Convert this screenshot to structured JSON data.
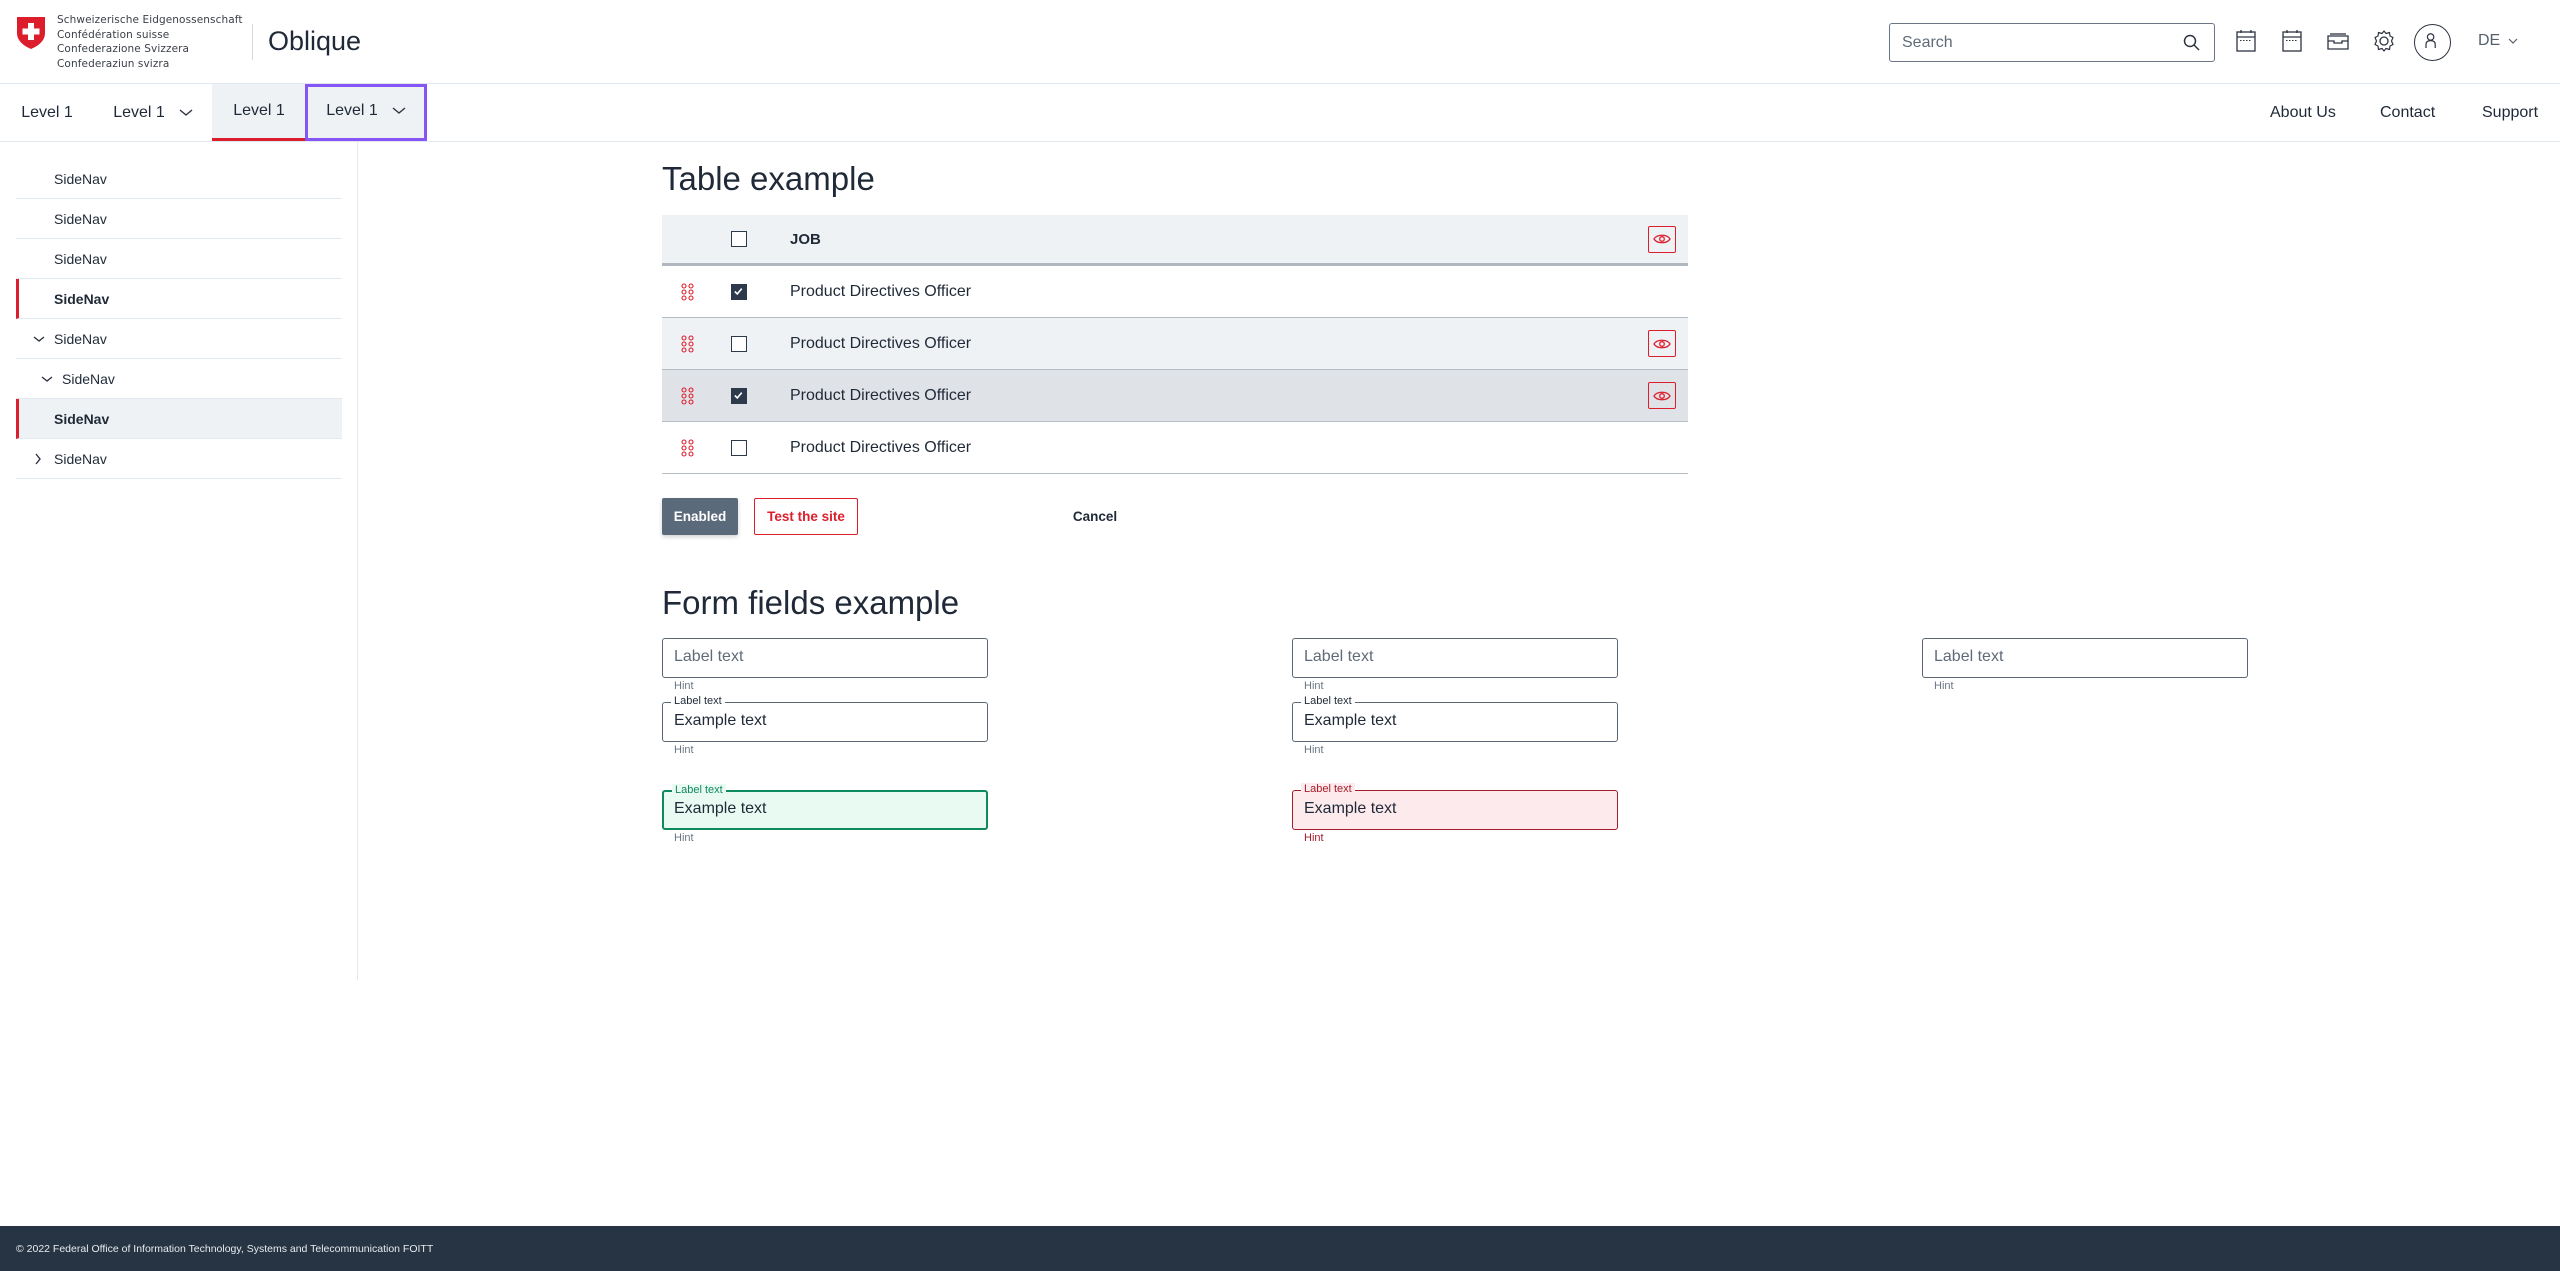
{
  "header": {
    "logo_lines": [
      "Schweizerische Eidgenossenschaft",
      "Confédération suisse",
      "Confederazione Svizzera",
      "Confederaziun svizra"
    ],
    "app_title": "Oblique",
    "search": {
      "placeholder": "Search",
      "value": ""
    },
    "icons": [
      "calendar-icon",
      "calendar-icon",
      "inbox-icon",
      "gear-icon",
      "user-icon"
    ],
    "language": "DE"
  },
  "top_nav": {
    "items": [
      {
        "label": "Level 1",
        "has_dropdown": false,
        "active": false,
        "focused": false
      },
      {
        "label": "Level 1",
        "has_dropdown": true,
        "active": false,
        "focused": false
      },
      {
        "label": "Level 1",
        "has_dropdown": false,
        "active": true,
        "focused": false
      },
      {
        "label": "Level 1",
        "has_dropdown": true,
        "active": true,
        "focused": true
      }
    ],
    "right_links": [
      "About Us",
      "Contact",
      "Support"
    ]
  },
  "sidebar": {
    "items": [
      {
        "label": "SideNav",
        "state": "default",
        "icon": null
      },
      {
        "label": "SideNav",
        "state": "default",
        "icon": null
      },
      {
        "label": "SideNav",
        "state": "default",
        "icon": null
      },
      {
        "label": "SideNav",
        "state": "active",
        "icon": null
      },
      {
        "label": "SideNav",
        "state": "expanded",
        "icon": "chevron-down-icon"
      },
      {
        "label": "SideNav",
        "state": "expanded-nested",
        "icon": "chevron-down-icon"
      },
      {
        "label": "SideNav",
        "state": "active-highlighted",
        "icon": null
      },
      {
        "label": "SideNav",
        "state": "collapsed",
        "icon": "chevron-right-icon"
      }
    ]
  },
  "table_section": {
    "title": "Table example",
    "header": {
      "column": "JOB",
      "checked": false
    },
    "rows": [
      {
        "job": "Product Directives Officer",
        "checked": true,
        "show_eye": false
      },
      {
        "job": "Product Directives Officer",
        "checked": false,
        "show_eye": true
      },
      {
        "job": "Product Directives Officer",
        "checked": true,
        "show_eye": true
      },
      {
        "job": "Product Directives Officer",
        "checked": false,
        "show_eye": false
      }
    ],
    "buttons": {
      "primary": "Enabled",
      "secondary": "Test the site",
      "tertiary": "Cancel"
    }
  },
  "form_section": {
    "title": "Form fields example",
    "fields": [
      {
        "label": "Label text",
        "value": "",
        "hint": "Hint",
        "state": "empty"
      },
      {
        "label": "Label text",
        "value": "",
        "hint": "Hint",
        "state": "empty"
      },
      {
        "label": "Label text",
        "value": "",
        "hint": "Hint",
        "state": "empty"
      },
      {
        "label": "Label text",
        "value": "Example text",
        "hint": "Hint",
        "state": "filled"
      },
      {
        "label": "Label text",
        "value": "Example text",
        "hint": "Hint",
        "state": "filled"
      },
      {
        "label": "Label text",
        "value": "Example text",
        "hint": "Hint",
        "state": "success"
      },
      {
        "label": "Label text",
        "value": "Example text",
        "hint": "Hint",
        "state": "error"
      }
    ]
  },
  "footer": {
    "text": "© 2022 Federal Office of Information Technology, Systems and Telecommunication FOITT"
  },
  "colors": {
    "accent_red": "#dc1e2c",
    "focus_purple": "#8655f6",
    "success_green": "#0f8a5f",
    "error_red": "#a51c2b",
    "footer_bg": "#263444",
    "primary_button": "#5b6a7b"
  }
}
